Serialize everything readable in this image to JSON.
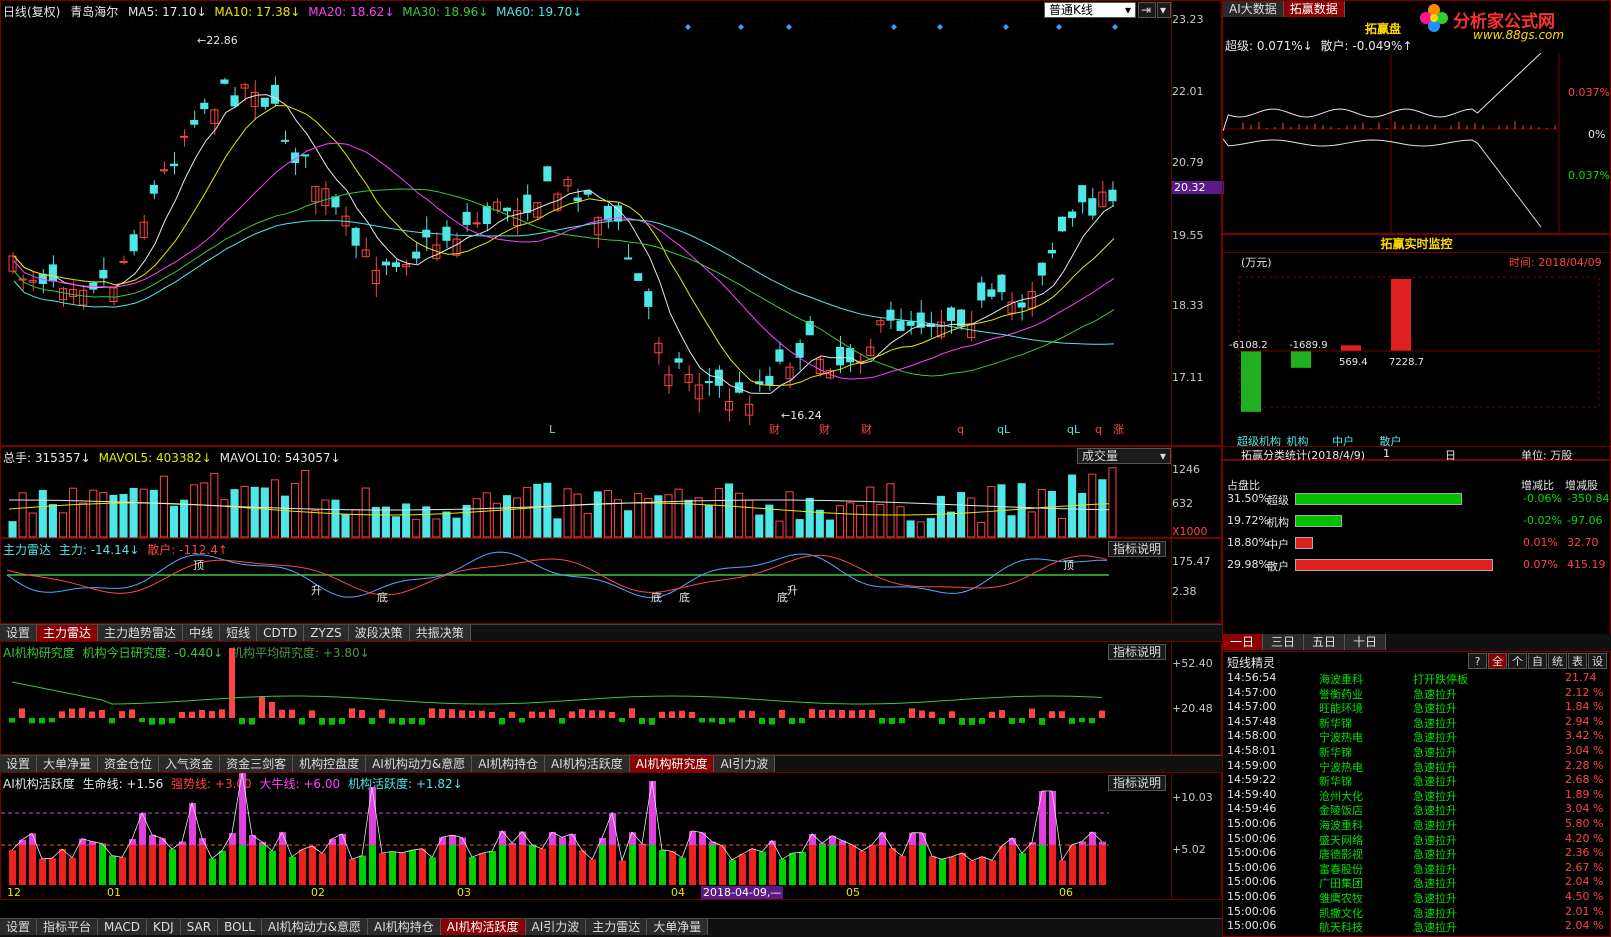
{
  "colors": {
    "up": "#ff4444",
    "down": "#00e000",
    "cyan": "#4fe6e6",
    "yellow": "#e8e800",
    "magenta": "#ff40ff",
    "frame": "#7a0000"
  },
  "main": {
    "period": "日线(复权)",
    "stock": "青岛海尔",
    "ma5": "MA5: 17.10↓",
    "ma10": "MA10: 17.38↓",
    "ma20": "MA20: 18.62↓",
    "ma30": "MA30: 18.96↓",
    "ma60": "MA60: 19.70↓",
    "chart_type": "普通K线",
    "y_labels": [
      "23.23",
      "22.01",
      "20.79",
      "19.55",
      "18.33",
      "17.11"
    ],
    "current_price": "20.32",
    "high_mark": "22.86",
    "low_mark": "16.24",
    "event_labels": [
      "L",
      "财",
      "财",
      "财",
      "q",
      "qL",
      "qL",
      "q",
      "涨"
    ]
  },
  "volume": {
    "total": "总手: 315357↓",
    "mavol5": "MAVOL5: 403382↓",
    "mavol10": "MAVOL10: 543057↓",
    "dropdown": "成交量",
    "y_labels": [
      "1246",
      "632",
      "X1000"
    ]
  },
  "radar": {
    "title": "主力雷达",
    "main_force": "主力: -14.14↓",
    "retail": "散户: -112.4↑",
    "explain": "指标说明",
    "y_labels": [
      "175.47",
      "2.38"
    ],
    "signals": [
      "顶",
      "升",
      "底",
      "底",
      "底",
      "底",
      "升",
      "顶"
    ]
  },
  "tabs1": [
    "设置",
    "主力雷达",
    "主力趋势雷达",
    "中线",
    "短线",
    "CDTD",
    "ZYZS",
    "波段决策",
    "共振决策"
  ],
  "research": {
    "title": "AI机构研究度",
    "today": "机构今日研究度: -0.440↓",
    "avg": "机构平均研究度: +3.80↓",
    "explain": "指标说明",
    "y_labels": [
      "+52.40",
      "+20.48"
    ]
  },
  "tabs2": [
    "设置",
    "大单净量",
    "资金仓位",
    "入气资金",
    "资金三剑客",
    "机构控盘度",
    "AI机构动力&意愿",
    "AI机构持仓",
    "AI机构活跃度",
    "AI机构研究度",
    "AI引力波"
  ],
  "activity": {
    "title": "AI机构活跃度",
    "life": "生命线: +1.56",
    "strong": "强势线: +3.00",
    "bull": "大牛线: +6.00",
    "active": "机构活跃度: +1.82↓",
    "explain": "指标说明",
    "y_labels": [
      "+10.03",
      "+5.02"
    ]
  },
  "dates": [
    "12",
    "01",
    "02",
    "03",
    "04",
    "05",
    "06"
  ],
  "date_cursor": "2018-04-09,—",
  "tabs3": [
    "设置",
    "指标平台",
    "MACD",
    "KDJ",
    "SAR",
    "BOLL",
    "AI机构动力&意愿",
    "AI机构持仓",
    "AI机构活跃度",
    "AI引力波",
    "主力雷达",
    "大单净量"
  ],
  "right": {
    "tabs": [
      "AI大数据",
      "拓赢数据"
    ],
    "logo": "分析家公式网",
    "logo_url": "www.88gs.com",
    "panel_title": "拓赢盘",
    "super_pct": "超级: 0.071%↓",
    "retail_pct": "散户: -0.049%↑",
    "minute_labels": [
      "0.037%",
      "0%",
      "0.037%"
    ],
    "monitor_title": "拓赢实时监控",
    "unit": "(万元)",
    "time": "时间: 2018/04/09",
    "bar_values": [
      "-6108.2",
      "-1689.9",
      "569.4",
      "7228.7"
    ],
    "bar_labels": [
      "超级机构",
      "机构",
      "中户",
      "散户"
    ],
    "stat_title": "拓赢分类统计(2018/4/9)",
    "stat_n": "1",
    "stat_day": "日",
    "stat_unit": "单位: 万股",
    "hdr": [
      "占盘比",
      "增减比",
      "增减股"
    ],
    "rows": [
      {
        "pct": "31.50%",
        "name": "超级",
        "ratio": "-0.06%",
        "shares": "-350.84",
        "fill": 0.75,
        "color": "#00c000"
      },
      {
        "pct": "19.72%",
        "name": "机构",
        "ratio": "-0.02%",
        "shares": "-97.06",
        "fill": 0.21,
        "color": "#00c000"
      },
      {
        "pct": "18.80%",
        "name": "中户",
        "ratio": "0.01%",
        "shares": "32.70",
        "fill": 0.08,
        "color": "#e02020"
      },
      {
        "pct": "29.98%",
        "name": "散户",
        "ratio": "0.07%",
        "shares": "415.19",
        "fill": 0.89,
        "color": "#e02020"
      }
    ],
    "period_tabs": [
      "一日",
      "三日",
      "五日",
      "十日"
    ],
    "sprite_title": "短线精灵",
    "sprite_btns": [
      "?",
      "全",
      "个",
      "自",
      "统",
      "表",
      "设"
    ],
    "sprite": [
      {
        "t": "14:56:54",
        "n": "海波重科",
        "e": "打开跌停板",
        "v": "21.74"
      },
      {
        "t": "14:57:00",
        "n": "誉衡药业",
        "e": "急速拉升",
        "v": "2.12 %"
      },
      {
        "t": "14:57:00",
        "n": "旺能环境",
        "e": "急速拉升",
        "v": "1.84 %"
      },
      {
        "t": "14:57:48",
        "n": "新华锦",
        "e": "急速拉升",
        "v": "2.94 %"
      },
      {
        "t": "14:58:00",
        "n": "宁波热电",
        "e": "急速拉升",
        "v": "3.42 %"
      },
      {
        "t": "14:58:01",
        "n": "新华锦",
        "e": "急速拉升",
        "v": "3.04 %"
      },
      {
        "t": "14:59:00",
        "n": "宁波热电",
        "e": "急速拉升",
        "v": "2.28 %"
      },
      {
        "t": "14:59:22",
        "n": "新华锦",
        "e": "急速拉升",
        "v": "2.68 %"
      },
      {
        "t": "14:59:40",
        "n": "沧州大化",
        "e": "急速拉升",
        "v": "1.89 %"
      },
      {
        "t": "14:59:46",
        "n": "金陵饭店",
        "e": "急速拉升",
        "v": "3.04 %"
      },
      {
        "t": "15:00:06",
        "n": "海波重科",
        "e": "急速拉升",
        "v": "5.80 %"
      },
      {
        "t": "15:00:06",
        "n": "盛天网络",
        "e": "急速拉升",
        "v": "4.20 %"
      },
      {
        "t": "15:00:06",
        "n": "唐德影视",
        "e": "急速拉升",
        "v": "2.36 %"
      },
      {
        "t": "15:00:06",
        "n": "富春股份",
        "e": "急速拉升",
        "v": "2.67 %"
      },
      {
        "t": "15:00:06",
        "n": "广田集团",
        "e": "急速拉升",
        "v": "2.04 %"
      },
      {
        "t": "15:00:06",
        "n": "雏鹰农牧",
        "e": "急速拉升",
        "v": "4.50 %"
      },
      {
        "t": "15:00:06",
        "n": "凯撒文化",
        "e": "急速拉升",
        "v": "2.01 %"
      },
      {
        "t": "15:00:06",
        "n": "航天科技",
        "e": "急速拉升",
        "v": "2.04 %"
      }
    ]
  }
}
